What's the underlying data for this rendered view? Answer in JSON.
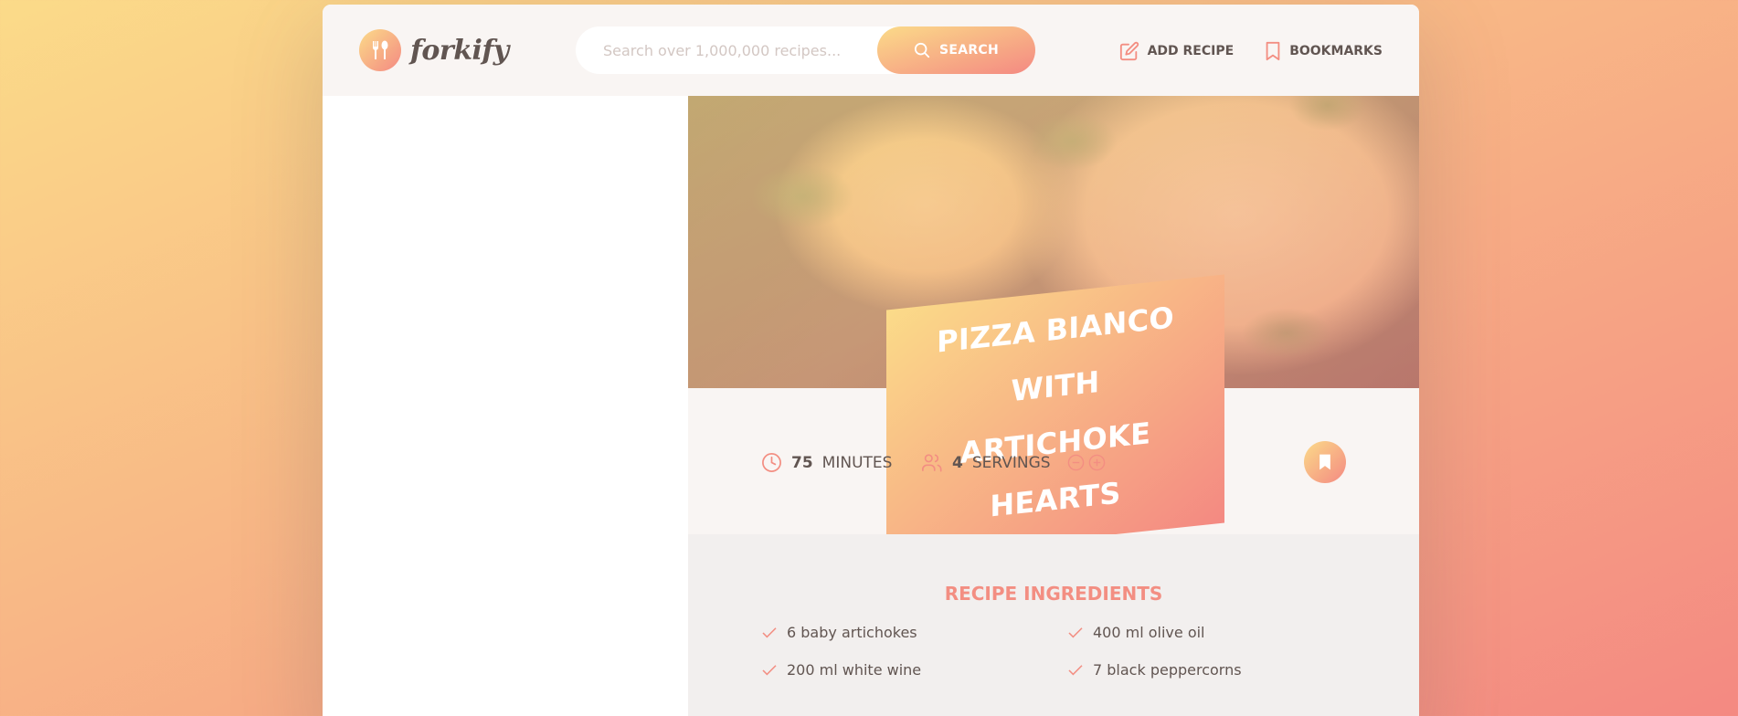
{
  "brand": {
    "name": "forkify",
    "logo_icon": "fork-spoon-icon"
  },
  "search": {
    "placeholder": "Search over 1,000,000 recipes...",
    "value": "",
    "button_label": "SEARCH",
    "icon": "search-icon"
  },
  "nav": {
    "add_recipe": {
      "label": "ADD RECIPE",
      "icon": "edit-icon"
    },
    "bookmarks": {
      "label": "BOOKMARKS",
      "icon": "bookmark-icon"
    }
  },
  "recipe": {
    "title_line1": "Pizza Bianco with",
    "title_line2": "Artichoke Hearts",
    "cooking_time": "75",
    "cooking_time_unit": "minutes",
    "servings": "4",
    "servings_unit": "servings"
  },
  "ingredients": {
    "heading": "RECIPE INGREDIENTS",
    "items": [
      "6 baby artichokes",
      "400 ml olive oil",
      "200 ml white wine",
      "7 black peppercorns"
    ]
  },
  "colors": {
    "accent_start": "#fbdb89",
    "accent_end": "#f48982",
    "text": "#615551",
    "panel": "#f9f5f3"
  }
}
